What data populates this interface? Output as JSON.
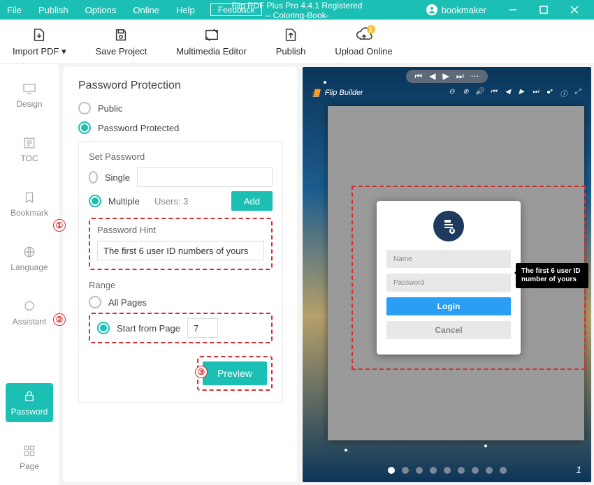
{
  "titlebar": {
    "menus": [
      "File",
      "Publish",
      "Options",
      "Online",
      "Help"
    ],
    "feedback": "Feedback",
    "title_line1": "Flip PDF Plus Pro 4.4.1 Registered",
    "title_line2": "-- Coloring-Book-",
    "user": "bookmaker"
  },
  "toolbar": {
    "import": "Import PDF ▾",
    "save": "Save Project",
    "multimedia": "Multimedia Editor",
    "publish": "Publish",
    "upload": "Upload Online",
    "upload_badge": "1"
  },
  "sidebar": {
    "items": [
      {
        "key": "design",
        "label": "Design"
      },
      {
        "key": "toc",
        "label": "TOC"
      },
      {
        "key": "bookmark",
        "label": "Bookmark"
      },
      {
        "key": "language",
        "label": "Language"
      },
      {
        "key": "assistant",
        "label": "Assistant"
      },
      {
        "key": "password",
        "label": "Password"
      },
      {
        "key": "page",
        "label": "Page"
      }
    ]
  },
  "panel": {
    "title": "Password Protection",
    "public": "Public",
    "protected": "Password Protected",
    "set_password": "Set Password",
    "single": "Single",
    "multiple": "Multiple",
    "users_label": "Users: 3",
    "add": "Add",
    "hint_label": "Password Hint",
    "hint_value": "The first 6 user ID numbers of yours",
    "range": "Range",
    "all_pages": "All Pages",
    "start_from": "Start from Page",
    "start_page": "7",
    "preview": "Preview"
  },
  "preview": {
    "brand": "Flip Builder",
    "login": {
      "name_ph": "Name",
      "pass_ph": "Password",
      "login": "Login",
      "cancel": "Cancel"
    },
    "tooltip": "The first 6 user ID number of yours",
    "page_num": "1"
  }
}
